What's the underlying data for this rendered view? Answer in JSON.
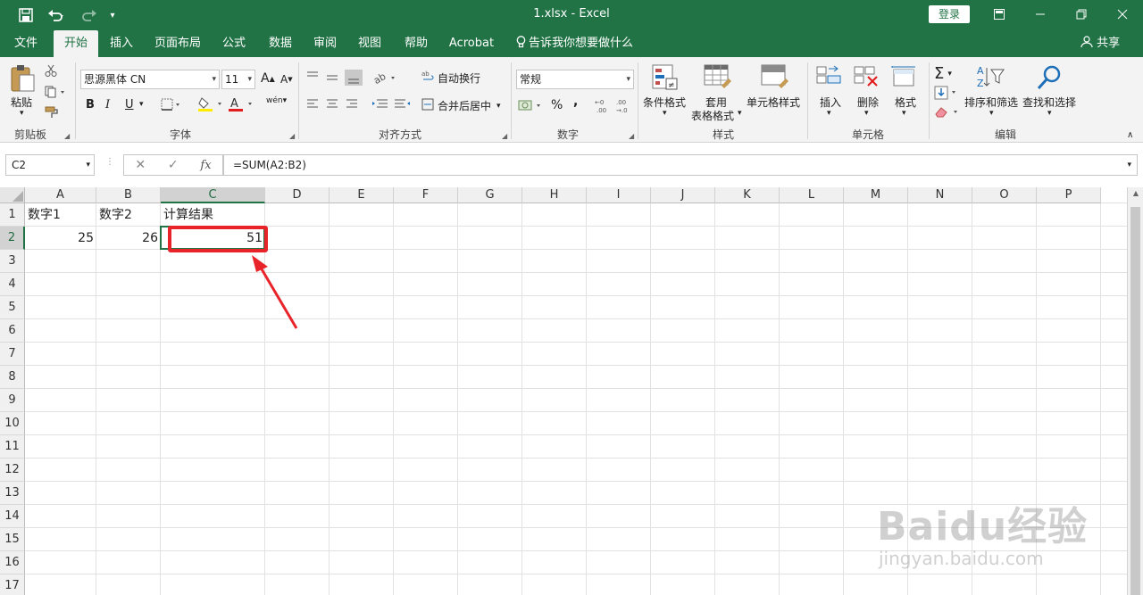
{
  "window": {
    "title": "1.xlsx  -  Excel",
    "login_label": "登录",
    "save_icon": "save-icon",
    "undo_icon": "undo-icon",
    "redo_icon": "redo-icon"
  },
  "tabs": [
    {
      "label": "文件"
    },
    {
      "label": "开始"
    },
    {
      "label": "插入"
    },
    {
      "label": "页面布局"
    },
    {
      "label": "公式"
    },
    {
      "label": "数据"
    },
    {
      "label": "审阅"
    },
    {
      "label": "视图"
    },
    {
      "label": "帮助"
    },
    {
      "label": "Acrobat"
    }
  ],
  "tell_me": "告诉我你想要做什么",
  "share_label": "共享",
  "ribbon": {
    "clipboard": {
      "paste": "粘贴",
      "label": "剪贴板"
    },
    "font": {
      "name": "思源黑体 CN",
      "size": "11",
      "bold": "B",
      "italic": "I",
      "underline": "U",
      "grow": "A",
      "shrink": "A",
      "label": "字体"
    },
    "alignment": {
      "wrap": "自动换行",
      "merge": "合并后居中",
      "label": "对齐方式"
    },
    "number": {
      "format": "常规",
      "percent": "%",
      "comma": ",",
      "label": "数字"
    },
    "styles": {
      "conditional": "条件格式",
      "table1": "套用",
      "table2": "表格格式",
      "cell_styles": "单元格样式",
      "label": "样式"
    },
    "cells": {
      "insert": "插入",
      "delete": "删除",
      "format": "格式",
      "label": "单元格"
    },
    "editing": {
      "sort": "排序和筛选",
      "find": "查找和选择",
      "label": "编辑"
    }
  },
  "formula_bar": {
    "name_box": "C2",
    "fx": "fx",
    "formula": "=SUM(A2:B2)"
  },
  "columns": [
    "A",
    "B",
    "C",
    "D",
    "E",
    "F",
    "G",
    "H",
    "I",
    "J",
    "K",
    "L",
    "M",
    "N",
    "O",
    "P"
  ],
  "rows": [
    "1",
    "2",
    "3",
    "4",
    "5",
    "6",
    "7",
    "8",
    "9",
    "10",
    "11",
    "12",
    "13",
    "14",
    "15",
    "16",
    "17"
  ],
  "cells": {
    "A1": "数字1",
    "B1": "数字2",
    "C1": "计算结果",
    "A2": "25",
    "B2": "26",
    "C2": "51"
  },
  "selected_cell": "C2",
  "accent_color": "#217346",
  "annotation_color": "#e8242a",
  "watermark": {
    "brand": "Baidu经验",
    "site": "jingyan.baidu.com"
  }
}
